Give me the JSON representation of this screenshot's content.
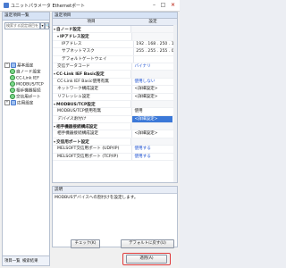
{
  "window": {
    "title": "ユニットパラメータ Ethernetポート",
    "minimize": "–",
    "maximize": "□",
    "close": "×"
  },
  "left_pane": {
    "header": "設定項目一覧",
    "search_placeholder": "検索する設定項目を",
    "search_button_1": "▾",
    "search_button_2": "🔍",
    "tree": [
      {
        "label": "基本設定",
        "expander": "−",
        "level": 0,
        "icon": "folder"
      },
      {
        "label": "自ノード設定",
        "level": 1,
        "icon": "item"
      },
      {
        "label": "CC-Link IEF",
        "level": 1,
        "icon": "item"
      },
      {
        "label": "MODBUS/TCP",
        "level": 1,
        "icon": "item"
      },
      {
        "label": "相手機器接続",
        "level": 1,
        "icon": "item"
      },
      {
        "label": "交信用ポート",
        "level": 1,
        "icon": "item"
      },
      {
        "label": "応用設定",
        "expander": "+",
        "level": 0,
        "icon": "folder"
      }
    ],
    "bottom_tabs": [
      "項目一覧",
      "検索結果"
    ]
  },
  "right_pane": {
    "header": "設定項目",
    "columns": [
      "項目",
      "設定"
    ],
    "rows": [
      {
        "item": "自ノード設定",
        "value": "",
        "level": 0,
        "group": true,
        "expand": "▾"
      },
      {
        "item": "IPアドレス設定",
        "value": "",
        "level": 1,
        "group": true,
        "expand": "▾"
      },
      {
        "item": "IPアドレス",
        "value": "192 . 168 . 250 . 10",
        "level": 2
      },
      {
        "item": "サブネットマスク",
        "value": "255 . 255 . 255 . 0",
        "level": 2
      },
      {
        "item": "デフォルトゲートウェイ",
        "value": "",
        "level": 2
      },
      {
        "item": "交信データコード",
        "value": "バイナリ",
        "level": 1
      },
      {
        "item": "CC-Link IEF Basic設定",
        "value": "",
        "level": 0,
        "group": true,
        "expand": "▾"
      },
      {
        "item": "CC-Link IEF Basic使用有無",
        "value": "使用しない",
        "level": 1,
        "link": true
      },
      {
        "item": "ネットワーク構成設定",
        "value": "<詳細設定>",
        "level": 1
      },
      {
        "item": "リフレッシュ設定",
        "value": "<詳細設定>",
        "level": 1
      },
      {
        "item": "MODBUS/TCP設定",
        "value": "",
        "level": 0,
        "group": true,
        "expand": "▾"
      },
      {
        "item": "MODBUS/TCP使用有無",
        "value": "使用",
        "level": 1
      },
      {
        "item": "デバイス割付け",
        "value": "<詳細設定>",
        "level": 1,
        "italic": true,
        "selected": true,
        "dropdown": "▾"
      },
      {
        "item": "相手機器接続構成設定",
        "value": "",
        "level": 0,
        "group": true,
        "expand": "▾"
      },
      {
        "item": "相手機器接続構成設定",
        "value": "<詳細設定>",
        "level": 1
      },
      {
        "item": "交信用ポート設定",
        "value": "",
        "level": 0,
        "group": true,
        "expand": "▾"
      },
      {
        "item": "MELSOFT交信用ポート (UDP/IP)",
        "value": "使用する",
        "level": 1,
        "link": true
      },
      {
        "item": "MELSOFT交信用ポート (TCP/IP)",
        "value": "使用する",
        "level": 1,
        "link": true
      }
    ],
    "description_header": "説明",
    "description_text": "MODBUSデバイスへの割付けを設定します。"
  },
  "buttons": {
    "check": "チェック(K)",
    "restore_default": "デフォルトに戻す(U)",
    "apply": "適用(A)"
  },
  "colors": {
    "accent": "#3b78d8",
    "link": "#1a4fd0",
    "highlight_box": "#e03a3a"
  }
}
